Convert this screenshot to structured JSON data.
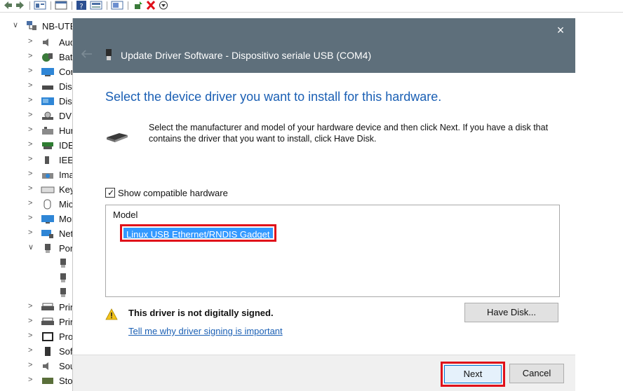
{
  "colors": {
    "titlebar": "#5e6f7b",
    "heading": "#1a5fb4",
    "selection": "#3399ff",
    "highlight_border": "#e0101a",
    "link": "#1a5fb4"
  },
  "toolbar": {
    "items": [
      {
        "name": "back-icon"
      },
      {
        "name": "forward-icon"
      },
      {
        "name": "properties-icon"
      },
      {
        "name": "console-icon"
      },
      {
        "name": "help-icon"
      },
      {
        "name": "view-icon"
      },
      {
        "name": "scan-icon"
      },
      {
        "name": "update-driver-icon"
      },
      {
        "name": "uninstall-icon"
      },
      {
        "name": "enable-icon"
      }
    ]
  },
  "tree": {
    "root_label": "NB-UTE",
    "items": [
      {
        "label": "Audio",
        "icon": "speaker-icon",
        "expanded": false
      },
      {
        "label": "Batterie",
        "icon": "battery-icon",
        "expanded": false
      },
      {
        "label": "Computer",
        "icon": "computer-icon",
        "expanded": false
      },
      {
        "label": "Disk",
        "icon": "disk-icon",
        "expanded": false
      },
      {
        "label": "Display",
        "icon": "display-icon",
        "expanded": false
      },
      {
        "label": "DVD",
        "icon": "dvd-icon",
        "expanded": false
      },
      {
        "label": "Human",
        "icon": "hid-icon",
        "expanded": false
      },
      {
        "label": "IDE",
        "icon": "ide-icon",
        "expanded": false
      },
      {
        "label": "IEEE",
        "icon": "ieee-icon",
        "expanded": false
      },
      {
        "label": "Imaging",
        "icon": "imaging-icon",
        "expanded": false
      },
      {
        "label": "Keyboard",
        "icon": "keyboard-icon",
        "expanded": false
      },
      {
        "label": "Mice",
        "icon": "mouse-icon",
        "expanded": false
      },
      {
        "label": "Monitor",
        "icon": "monitor-icon",
        "expanded": false
      },
      {
        "label": "Network",
        "icon": "network-icon",
        "expanded": false
      },
      {
        "label": "Porte",
        "icon": "port-icon",
        "expanded": true
      },
      {
        "label": "",
        "icon": "port-child-icon",
        "child": true
      },
      {
        "label": "",
        "icon": "port-child-icon",
        "child": true
      },
      {
        "label": "",
        "icon": "port-child-icon",
        "child": true
      },
      {
        "label": "Print",
        "icon": "printer-icon",
        "expanded": false
      },
      {
        "label": "Print",
        "icon": "printer-icon",
        "expanded": false
      },
      {
        "label": "Processor",
        "icon": "processor-icon",
        "expanded": false
      },
      {
        "label": "Software",
        "icon": "software-icon",
        "expanded": false
      },
      {
        "label": "Sound",
        "icon": "speaker-icon",
        "expanded": false
      },
      {
        "label": "Storage",
        "icon": "storage-icon",
        "expanded": false
      }
    ]
  },
  "dialog": {
    "title": "Update Driver Software - Dispositivo seriale USB (COM4)",
    "close_label": "×",
    "heading": "Select the device driver you want to install for this hardware.",
    "description": "Select the manufacturer and model of your hardware device and then click Next. If you have a disk that contains the driver that you want to install, click Have Disk.",
    "show_compatible_label": "Show compatible hardware",
    "show_compatible_checked": true,
    "model_header": "Model",
    "models": [
      "Linux USB Ethernet/RNDIS Gadget"
    ],
    "warning_text": "This driver is not digitally signed.",
    "warning_link": "Tell me why driver signing is important",
    "have_disk_label": "Have Disk...",
    "next_label": "Next",
    "cancel_label": "Cancel"
  }
}
